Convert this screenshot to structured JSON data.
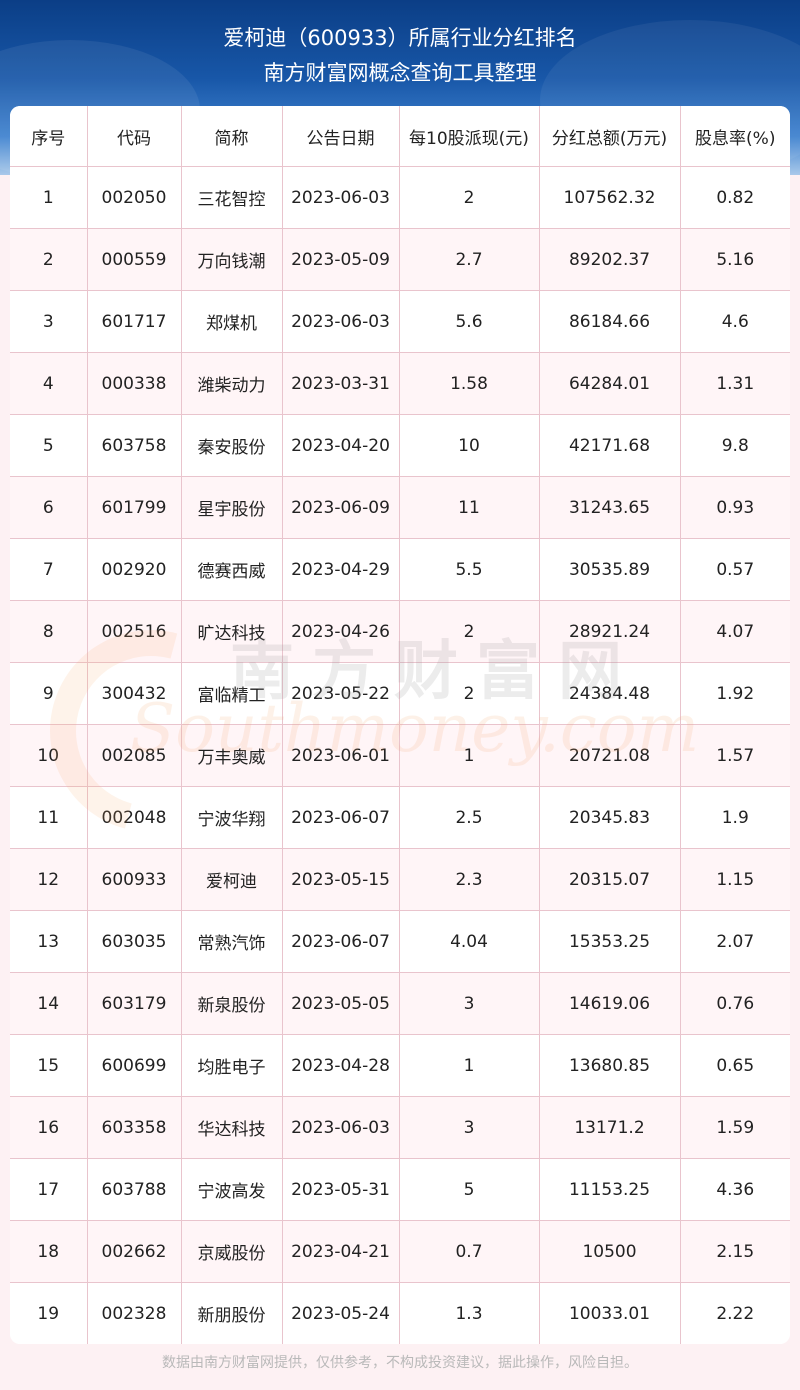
{
  "header": {
    "title_line1": "爱柯迪（600933）所属行业分红排名",
    "title_line2": "南方财富网概念查询工具整理"
  },
  "table": {
    "columns": [
      "序号",
      "代码",
      "简称",
      "公告日期",
      "每10股派现(元)",
      "分红总额(万元)",
      "股息率(%)"
    ],
    "rows": [
      [
        "1",
        "002050",
        "三花智控",
        "2023-06-03",
        "2",
        "107562.32",
        "0.82"
      ],
      [
        "2",
        "000559",
        "万向钱潮",
        "2023-05-09",
        "2.7",
        "89202.37",
        "5.16"
      ],
      [
        "3",
        "601717",
        "郑煤机",
        "2023-06-03",
        "5.6",
        "86184.66",
        "4.6"
      ],
      [
        "4",
        "000338",
        "潍柴动力",
        "2023-03-31",
        "1.58",
        "64284.01",
        "1.31"
      ],
      [
        "5",
        "603758",
        "秦安股份",
        "2023-04-20",
        "10",
        "42171.68",
        "9.8"
      ],
      [
        "6",
        "601799",
        "星宇股份",
        "2023-06-09",
        "11",
        "31243.65",
        "0.93"
      ],
      [
        "7",
        "002920",
        "德赛西威",
        "2023-04-29",
        "5.5",
        "30535.89",
        "0.57"
      ],
      [
        "8",
        "002516",
        "旷达科技",
        "2023-04-26",
        "2",
        "28921.24",
        "4.07"
      ],
      [
        "9",
        "300432",
        "富临精工",
        "2023-05-22",
        "2",
        "24384.48",
        "1.92"
      ],
      [
        "10",
        "002085",
        "万丰奥威",
        "2023-06-01",
        "1",
        "20721.08",
        "1.57"
      ],
      [
        "11",
        "002048",
        "宁波华翔",
        "2023-06-07",
        "2.5",
        "20345.83",
        "1.9"
      ],
      [
        "12",
        "600933",
        "爱柯迪",
        "2023-05-15",
        "2.3",
        "20315.07",
        "1.15"
      ],
      [
        "13",
        "603035",
        "常熟汽饰",
        "2023-06-07",
        "4.04",
        "15353.25",
        "2.07"
      ],
      [
        "14",
        "603179",
        "新泉股份",
        "2023-05-05",
        "3",
        "14619.06",
        "0.76"
      ],
      [
        "15",
        "600699",
        "均胜电子",
        "2023-04-28",
        "1",
        "13680.85",
        "0.65"
      ],
      [
        "16",
        "603358",
        "华达科技",
        "2023-06-03",
        "3",
        "13171.2",
        "1.59"
      ],
      [
        "17",
        "603788",
        "宁波高发",
        "2023-05-31",
        "5",
        "11153.25",
        "4.36"
      ],
      [
        "18",
        "002662",
        "京威股份",
        "2023-04-21",
        "0.7",
        "10500",
        "2.15"
      ],
      [
        "19",
        "002328",
        "新朋股份",
        "2023-05-24",
        "1.3",
        "10033.01",
        "2.22"
      ]
    ]
  },
  "watermark": {
    "cn": "南方财富网",
    "en": "Southmoney.com"
  },
  "footer": {
    "disclaimer": "数据由南方财富网提供，仅供参考，不构成投资建议，据此操作，风险自担。"
  },
  "colors": {
    "header_top": "#0b3e86",
    "header_bottom": "#a9c9ea",
    "page_background": "#fdf1f3",
    "grid_line": "#e9c4cd",
    "footer_text": "#b9b9b9"
  }
}
